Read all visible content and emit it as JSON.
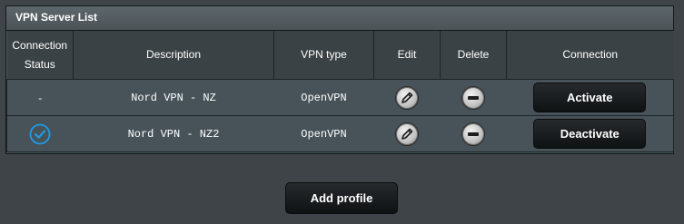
{
  "panel": {
    "title": "VPN Server List"
  },
  "columns": {
    "status_line1": "Connection",
    "status_line2": "Status",
    "description": "Description",
    "vpn_type": "VPN type",
    "edit": "Edit",
    "delete": "Delete",
    "connection": "Connection"
  },
  "rows": [
    {
      "status": "-",
      "connected": false,
      "description": "Nord VPN - NZ",
      "vpn_type": "OpenVPN",
      "edit_icon": "pencil-icon",
      "delete_icon": "minus-circle-icon",
      "action_label": "Activate"
    },
    {
      "status": "",
      "connected": true,
      "status_icon": "check-circle-icon",
      "description": "Nord VPN - NZ2",
      "vpn_type": "OpenVPN",
      "edit_icon": "pencil-icon",
      "delete_icon": "minus-circle-icon",
      "action_label": "Deactivate"
    }
  ],
  "footer": {
    "add_label": "Add profile"
  },
  "colors": {
    "background": "#3e4447",
    "panel": "#475359",
    "header": "#3b4245",
    "button": "#161a1c",
    "check_blue": "#1e9be8"
  }
}
